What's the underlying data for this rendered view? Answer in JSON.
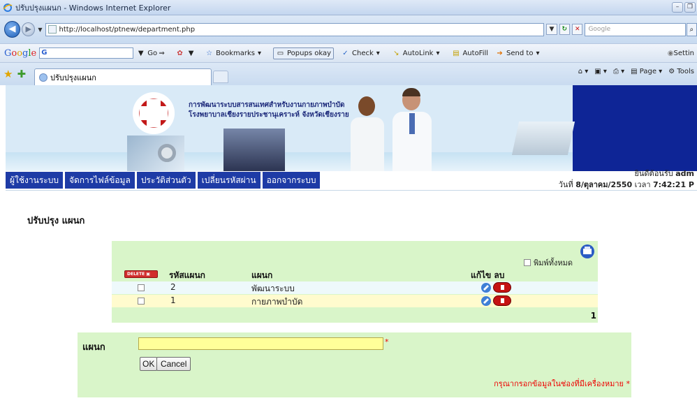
{
  "window": {
    "title": "ปรับปรุงแผนก - Windows Internet Explorer"
  },
  "address": {
    "url": "http://localhost/ptnew/department.php",
    "search_placeholder": "Google"
  },
  "google_toolbar": {
    "go_label": "Go",
    "bookmarks_label": "Bookmarks",
    "popups_label": "Popups okay",
    "check_label": "Check",
    "autolink_label": "AutoLink",
    "autofill_label": "AutoFill",
    "sendto_label": "Send to",
    "settings_label": "Settin"
  },
  "tabs": {
    "active_tab": "ปรับปรุงแผนก",
    "page_label": "Page",
    "tools_label": "Tools"
  },
  "banner": {
    "line1": "การพัฒนาระบบสารสนเทศสำหรับงานกายภาพบำบัด",
    "line2": "โรงพยาบาลเชียงรายประชานุเคราะห์  จังหวัดเชียงราย"
  },
  "menu": {
    "items": [
      "ผู้ใช้งานระบบ",
      "จัดการไฟล์ข้อมูล",
      "ประวัติส่วนตัว",
      "เปลี่ยนรหัสผ่าน",
      "ออกจากระบบ"
    ]
  },
  "welcome": {
    "line1_prefix": "ยินดีต้อนรับ",
    "user": "adm",
    "line2_prefix": "วันที่",
    "date": "8/ตุลาคม/2550",
    "time_prefix": "เวลา",
    "time": "7:42:21 P"
  },
  "page_title": "ปรับปรุง แผนก",
  "grid": {
    "print_all_label": "พิมพ์ทั้งหมด",
    "delete_label": "DELETE",
    "columns": {
      "code": "รหัสแผนก",
      "dept": "แผนก",
      "actions": "แก้ไข  ลบ"
    },
    "rows": [
      {
        "code": "2",
        "name": "พัฒนาระบบ"
      },
      {
        "code": "1",
        "name": "กายภาพบำบัด"
      }
    ],
    "page_number": "1"
  },
  "form": {
    "label": "แผนก",
    "input_value": "",
    "required_star": "*",
    "ok_label": "OK",
    "cancel_label": "Cancel",
    "hint": "กรุณากรอกข้อมูลในช่องที่มีเครื่องหมาย *"
  },
  "colors": {
    "menu_bg": "#1e3ba6",
    "panel_bg": "#d9f5c9",
    "row1_bg": "#eef9fb",
    "row2_bg": "#fffbce",
    "input_bg": "#ffff99",
    "required_red": "#e00000"
  }
}
